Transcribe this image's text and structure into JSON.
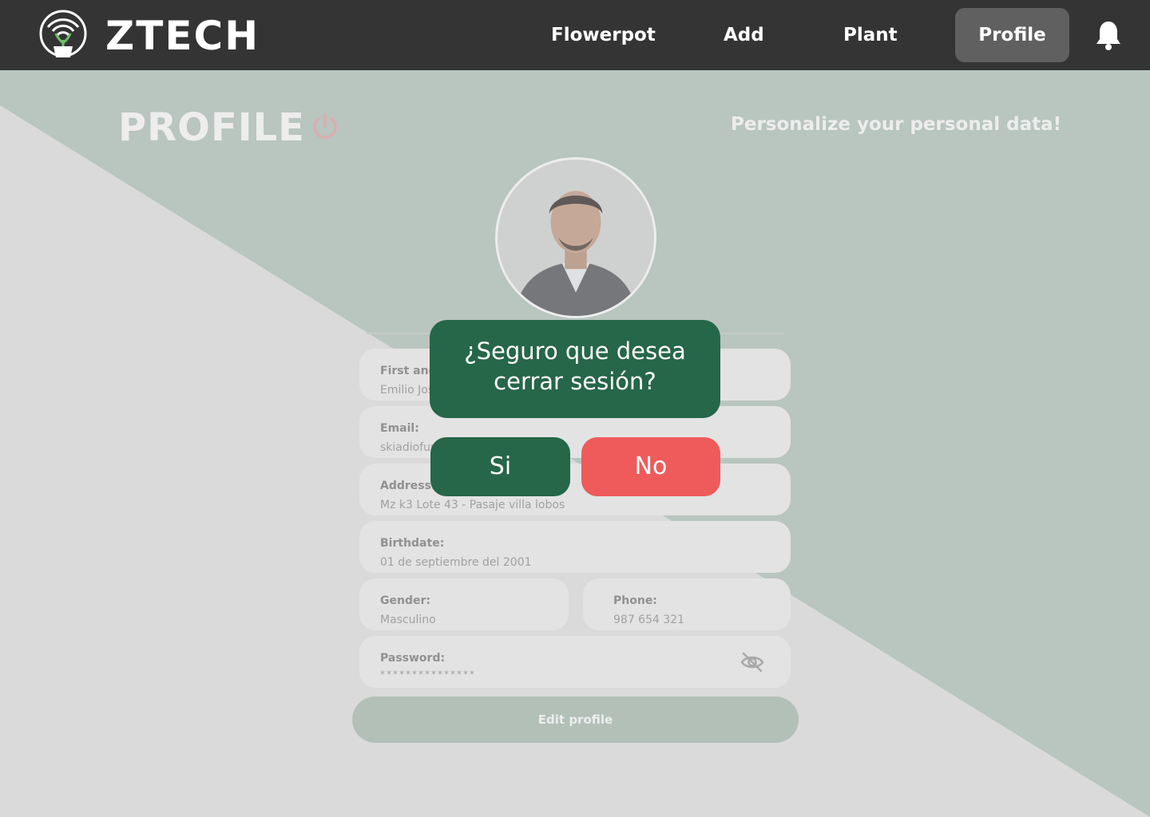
{
  "header": {
    "brand": "ZTECH",
    "nav": {
      "flowerpot": "Flowerpot",
      "add": "Add",
      "plant": "Plant",
      "profile": "Profile"
    },
    "logo_icon": "wifi-plant-pot-logo",
    "bell_icon": "bell-icon"
  },
  "page": {
    "title": "PROFILE",
    "tagline": "Personalize your personal data!",
    "power_icon": "power-icon"
  },
  "form": {
    "name_label": "First and last name:",
    "name_value": "Emilio José",
    "email_label": "Email:",
    "email_value": "skiadiofun",
    "address_label": "Address:",
    "address_value": "Mz k3 Lote 43 - Pasaje villa lobos",
    "birthdate_label": "Birthdate:",
    "birthdate_value": "01 de septiembre del 2001",
    "gender_label": "Gender:",
    "gender_value": "Masculino",
    "phone_label": "Phone:",
    "phone_value": "987 654 321",
    "password_label": "Password:",
    "password_value": "***************",
    "edit_button": "Edit profile"
  },
  "modal": {
    "line1": "¿Seguro que desea",
    "line2": "cerrar sesión?",
    "yes": "Si",
    "no": "No"
  },
  "colors": {
    "navbar": "#343434",
    "nav_active": "#606060",
    "green_panel": "#b3c5bc",
    "light_panel": "#e4e4e4",
    "modal_green": "#266649",
    "danger_red": "#ef5a5b"
  }
}
